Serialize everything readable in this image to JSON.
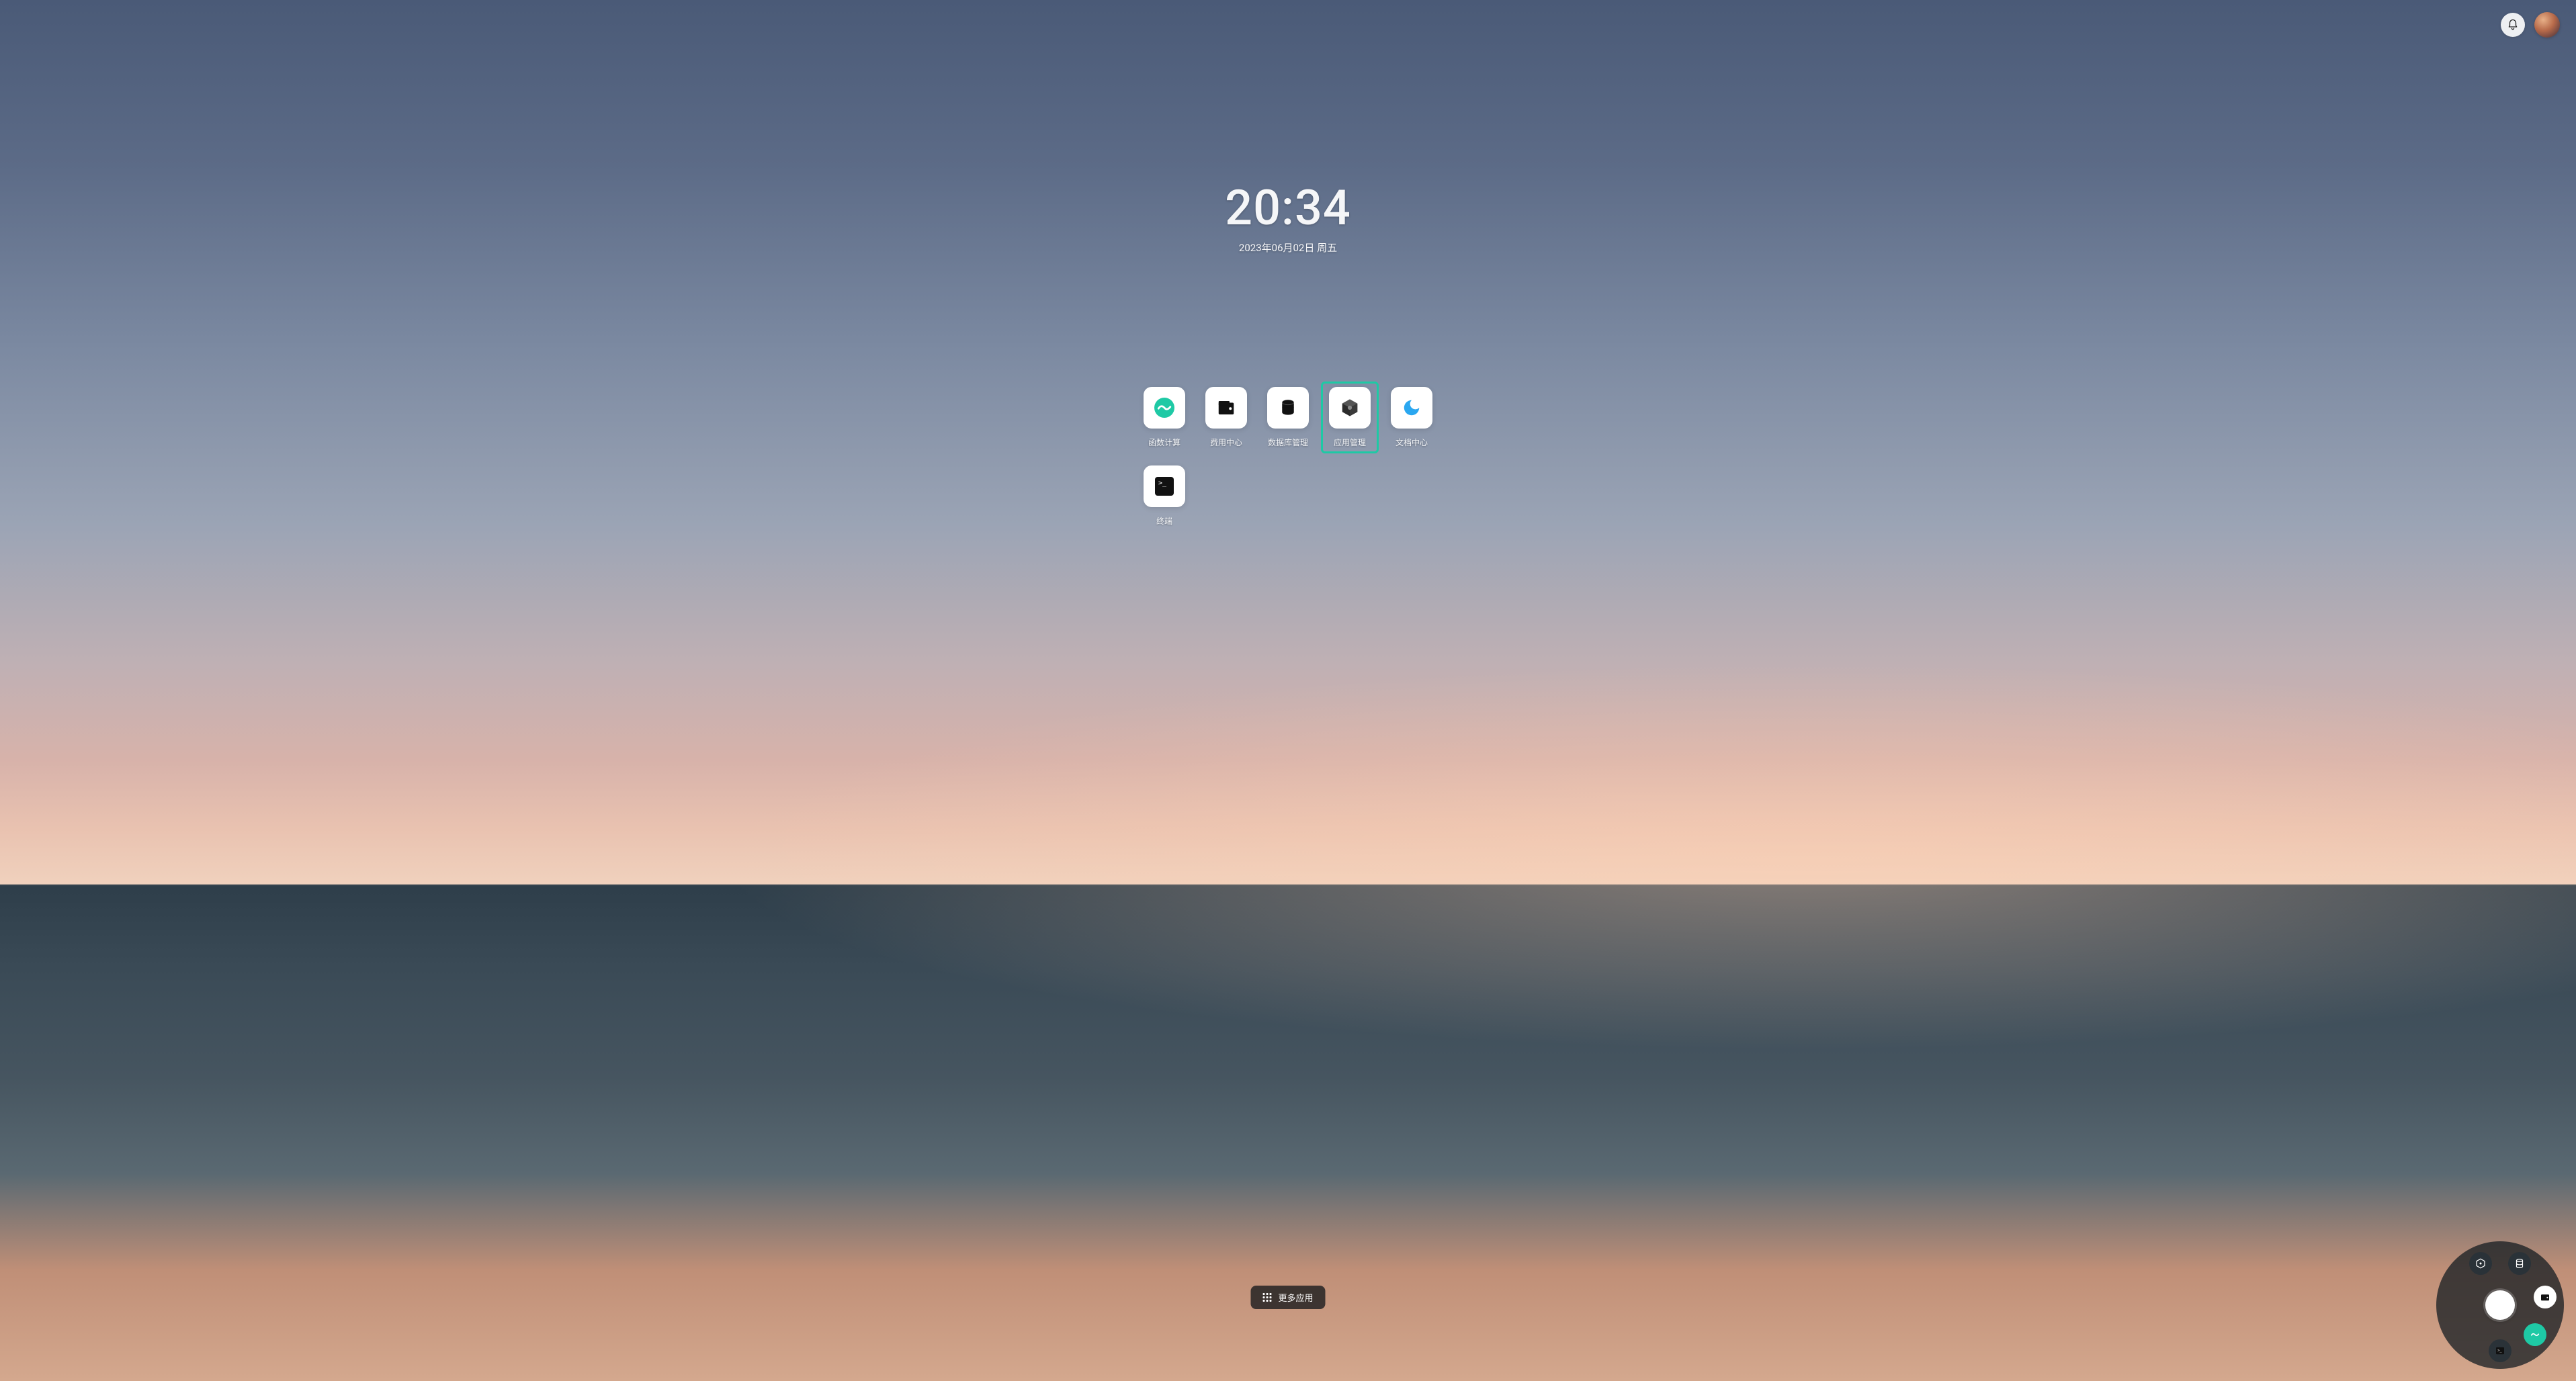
{
  "clock": {
    "time": "20:34",
    "date": "2023年06月02日 周五"
  },
  "apps": [
    {
      "id": "faas",
      "label": "函数计算",
      "icon": "wave-icon",
      "highlighted": false
    },
    {
      "id": "billing",
      "label": "费用中心",
      "icon": "wallet-icon",
      "highlighted": false
    },
    {
      "id": "db",
      "label": "数据库管理",
      "icon": "database-icon",
      "highlighted": false
    },
    {
      "id": "appmgr",
      "label": "应用管理",
      "icon": "hexagon-icon",
      "highlighted": true
    },
    {
      "id": "docs",
      "label": "文档中心",
      "icon": "swirl-icon",
      "highlighted": false
    },
    {
      "id": "terminal",
      "label": "终端",
      "icon": "terminal-icon",
      "highlighted": false
    }
  ],
  "more_apps_label": "更多应用",
  "radial_dock": {
    "center": "home",
    "items": [
      {
        "icon": "hexagon-icon",
        "style": "dark",
        "angle": -115
      },
      {
        "icon": "database-icon",
        "style": "dark",
        "angle": -65
      },
      {
        "icon": "wallet-icon",
        "style": "white",
        "angle": -10
      },
      {
        "icon": "wave-icon",
        "style": "teal",
        "angle": 40
      },
      {
        "icon": "terminal-icon",
        "style": "dark",
        "angle": 90
      }
    ]
  },
  "colors": {
    "accent": "#1ec9a5",
    "blue": "#2aa7f0"
  }
}
